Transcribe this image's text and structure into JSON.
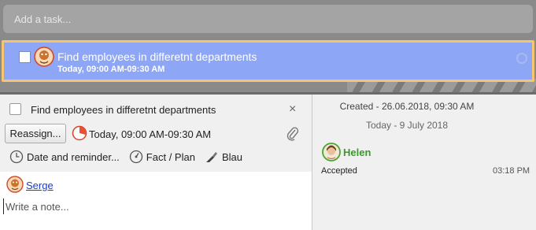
{
  "add_task": {
    "placeholder": "Add a task..."
  },
  "task_row": {
    "title": "Find employees in differetnt departments",
    "time": "Today, 09:00 AM-09:30 AM"
  },
  "detail": {
    "title": "Find employees in differetnt departments",
    "close_glyph": "×",
    "reassign_label": "Reassign...",
    "due_text": "Today, 09:00 AM-09:30 AM",
    "toolbar": {
      "date_reminder": "Date and reminder...",
      "fact_plan": "Fact / Plan",
      "color": "Blau"
    },
    "author": "Serge",
    "note_placeholder": "Write a note..."
  },
  "history": {
    "created": "Created - 26.06.2018, 09:30 AM",
    "today_label": "Today - 9 July 2018",
    "user": "Helen",
    "status": "Accepted",
    "time": "03:18 PM"
  },
  "colors": {
    "selected_row": "#8ea6f6",
    "row_border": "#f4c76e",
    "user_green": "#3a9a2a",
    "link_blue": "#1a3ec9"
  }
}
